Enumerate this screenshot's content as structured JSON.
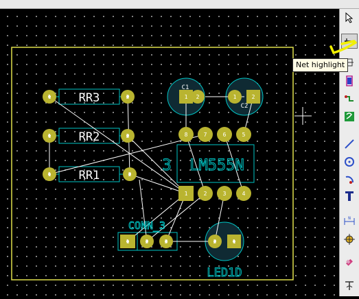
{
  "tooltip": {
    "text": "Net highlight"
  },
  "components": {
    "r3": "RR3",
    "r2": "RR2",
    "r1": "RR1",
    "ic": "LM555N",
    "ic_ref": "3",
    "c1": "C1",
    "c2": "C2",
    "conn": "CONN_3",
    "led": "LED1D"
  },
  "pad_numbers": {
    "ic_top": [
      "8",
      "7",
      "6",
      "5"
    ],
    "ic_bottom": [
      "1",
      "2",
      "3",
      "4"
    ],
    "conn": [
      "1",
      "2",
      "3"
    ],
    "led": [
      "2",
      "1"
    ],
    "resistor": [
      "1",
      "2"
    ],
    "cap": [
      "1",
      "2"
    ]
  },
  "toolbar": {
    "icons": [
      "select-arrow-icon",
      "net-highlight-icon",
      "local-ratsnest-icon",
      "add-module-icon",
      "add-tracks-icon",
      "add-zone-icon",
      "add-line-icon",
      "add-circle-icon",
      "add-arc-icon",
      "add-text-icon",
      "dimension-icon",
      "layer-alignment-target-icon",
      "delete-icon",
      "grid-origin-icon"
    ]
  },
  "colors": {
    "board_outline": "#e0e04c",
    "pad": "#b9b430",
    "silkscreen": "#00c6c6",
    "ratsnest": "#ffffff",
    "background": "#000000"
  }
}
